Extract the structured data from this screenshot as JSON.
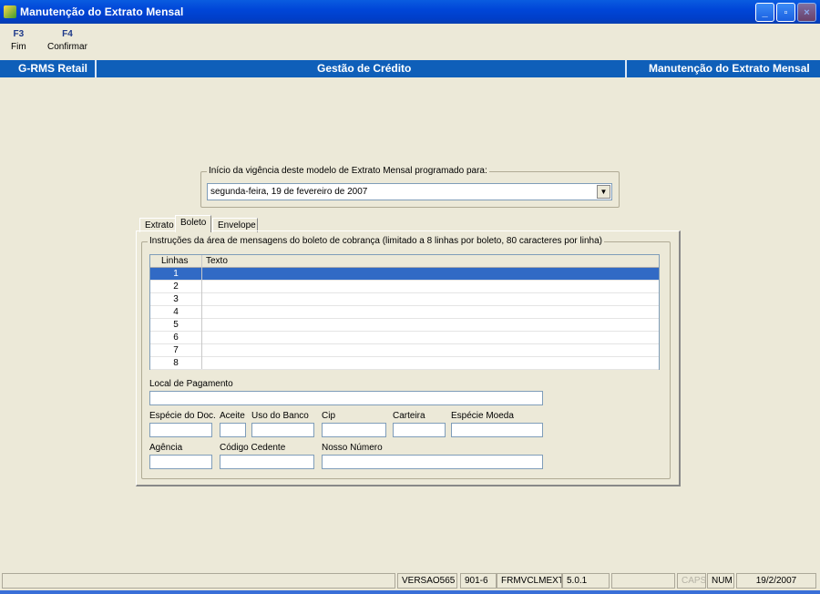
{
  "window": {
    "title": "Manutenção do Extrato Mensal",
    "buttons": [
      "_",
      "▫",
      "×"
    ]
  },
  "toolbar": {
    "fkeys": [
      {
        "key": "F3",
        "label": "Fim"
      },
      {
        "key": "F4",
        "label": "Confirmar"
      }
    ]
  },
  "header": {
    "app": "G-RMS Retail",
    "module": "Gestão de Crédito",
    "screen": "Manutenção do Extrato Mensal"
  },
  "vigencia": {
    "legend": "Início da vigência deste modelo de Extrato Mensal programado para:",
    "value": "segunda-feira, 19 de  fevereiro  de 2007"
  },
  "tabs": [
    "Extrato",
    "Boleto",
    "Envelope"
  ],
  "boleto": {
    "legend": "Instruções da área de mensagens do boleto de cobrança (limitado a 8 linhas por boleto, 80 caracteres por linha)",
    "columns": [
      "Linhas",
      "Texto"
    ],
    "rows": [
      "1",
      "2",
      "3",
      "4",
      "5",
      "6",
      "7",
      "8"
    ],
    "labels": {
      "local": "Local de Pagamento",
      "especie_doc": "Espécie do Doc.",
      "aceite": "Aceite",
      "uso_banco": "Uso do Banco",
      "cip": "Cip",
      "carteira": "Carteira",
      "especie_moeda": "Espécie Moeda",
      "agencia": "Agência",
      "codigo_cedente": "Código Cedente",
      "nosso_numero": "Nosso Número"
    }
  },
  "status": {
    "versao": "VERSAO565",
    "code": "901-6",
    "form": "FRMVCLMEXTM",
    "build": "5.0.1",
    "caps": "CAPS",
    "num": "NUM",
    "date": "19/2/2007"
  }
}
